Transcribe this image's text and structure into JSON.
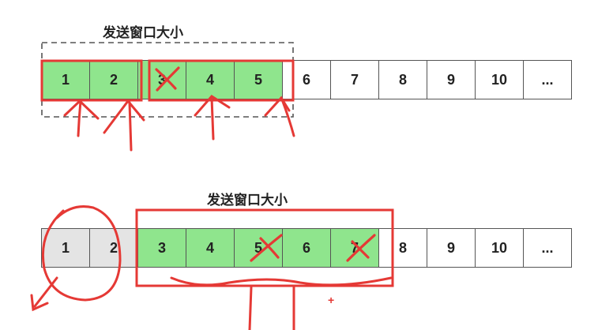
{
  "colors": {
    "acked_green": "#8fe58d",
    "sent_gray": "#e4e4e4",
    "annotation_red": "#e53935",
    "border": "#555555"
  },
  "top": {
    "window_label": "发送窗口大小",
    "cells": [
      "1",
      "2",
      "3",
      "4",
      "5",
      "6",
      "7",
      "8",
      "9",
      "10",
      "..."
    ]
  },
  "bottom": {
    "window_label": "发送窗口大小",
    "cells": [
      "1",
      "2",
      "3",
      "4",
      "5",
      "6",
      "7",
      "8",
      "9",
      "10",
      "..."
    ]
  }
}
